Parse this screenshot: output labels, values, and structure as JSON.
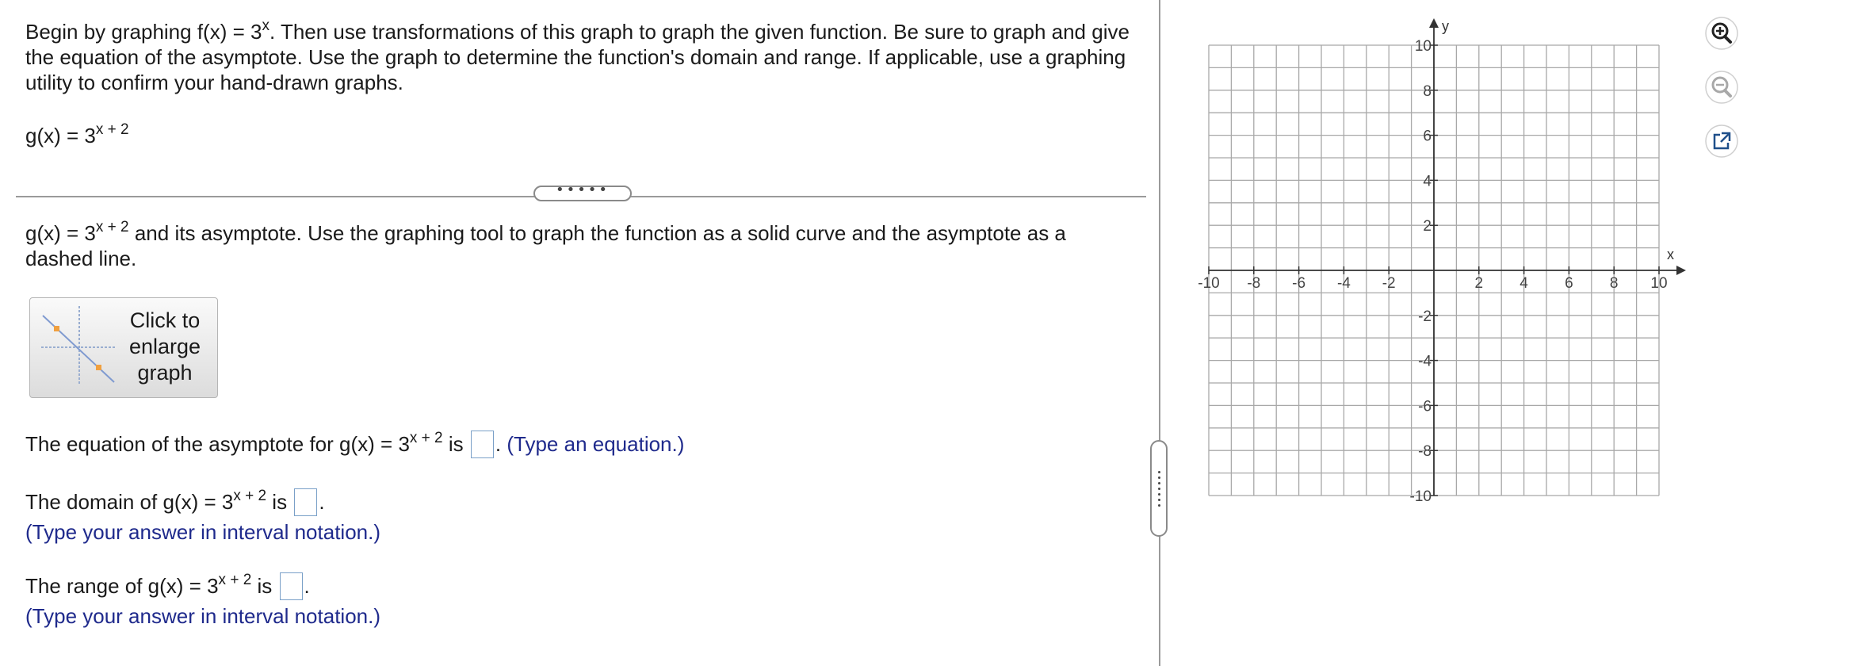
{
  "question": {
    "instructions_pre": "Begin by graphing f(x) = 3",
    "instructions_exp": "x",
    "instructions_line1_rest": ". Then use transformations of this graph to graph the given function. Be sure to graph and give",
    "instructions_line2": "the equation of the asymptote. Use the graph to determine the function's domain and range. If applicable, use a graphing",
    "instructions_line3": "utility to confirm your hand-drawn graphs.",
    "function_base": "g(x) = 3",
    "function_exp": "x + 2",
    "divider_dots": "•••••",
    "graph_prompt_rest": "and its asymptote. Use the graphing tool to graph the function as a solid curve and the asymptote as a",
    "graph_prompt_line2": "dashed line.",
    "enlarge_button": "Click to enlarge graph",
    "asymptote_prefix": "The equation of the asymptote for",
    "is_word": "is",
    "period": ".",
    "asymptote_hint": "(Type an equation.)",
    "domain_prefix": "The domain of",
    "range_prefix": "The range of",
    "interval_hint": "(Type your answer in interval notation.)"
  },
  "graph": {
    "x_axis_label": "x",
    "y_axis_label": "y",
    "x_range": [
      -10,
      10
    ],
    "y_range": [
      -10,
      10
    ],
    "grid_step": 1,
    "x_tick_labels": [
      "-10",
      "-8",
      "-6",
      "-4",
      "-2",
      "2",
      "4",
      "6",
      "8",
      "10"
    ],
    "y_tick_labels": [
      "10",
      "8",
      "6",
      "4",
      "2",
      "-2",
      "-4",
      "-6",
      "-8",
      "-10"
    ],
    "grid_color": "#a8a8a8",
    "axis_color": "#333333"
  },
  "tools": [
    "zoom-in-icon",
    "zoom-out-icon",
    "pop-out-icon"
  ]
}
